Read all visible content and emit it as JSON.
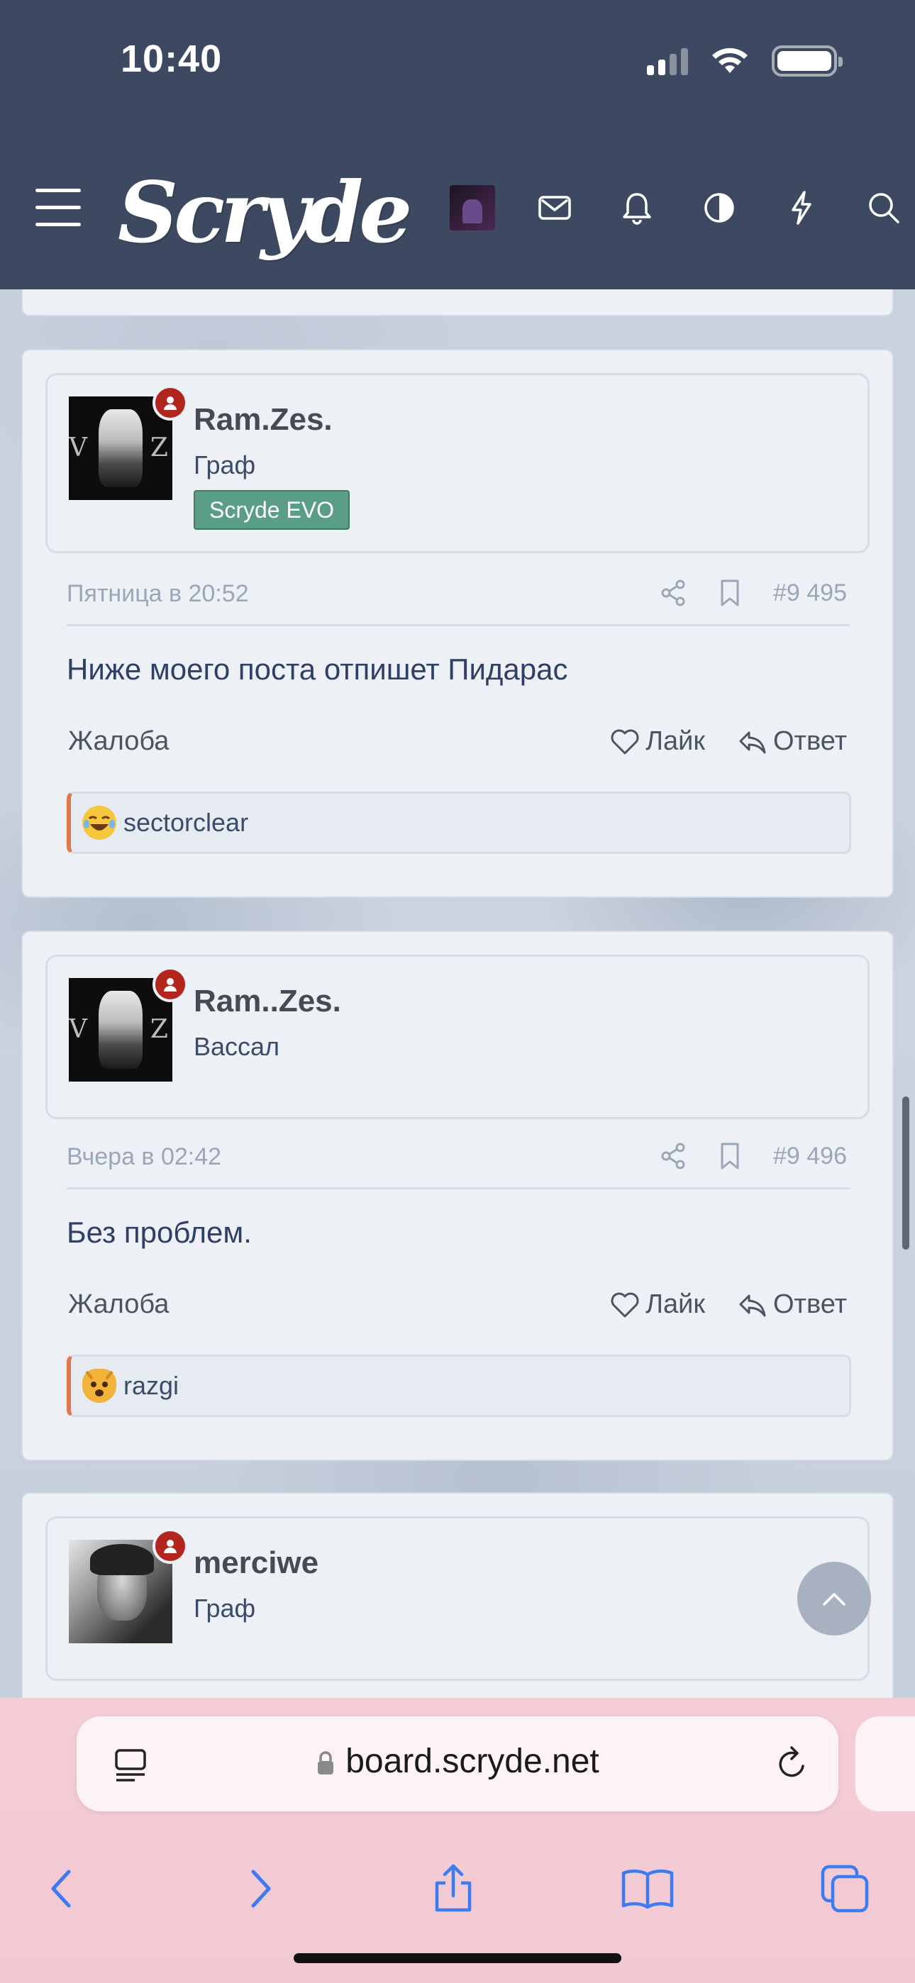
{
  "status_bar": {
    "time": "10:40"
  },
  "header": {
    "logo": "Scryde",
    "icons": [
      "menu-icon",
      "user-avatar",
      "mail-icon",
      "bell-icon",
      "contrast-icon",
      "bolt-icon",
      "search-icon"
    ]
  },
  "posts": [
    {
      "username": "Ram.Zes.",
      "user_title": "Граф",
      "banner": "Scryde EVO",
      "date": "Пятница в 20:52",
      "post_number": "#9 495",
      "text": "Ниже моего поста отпишет Пидарас",
      "report_label": "Жалоба",
      "like_label": "Лайк",
      "reply_label": "Ответ",
      "reaction_user": "sectorclear",
      "reaction_icon": "laughing-emoji-icon"
    },
    {
      "username": "Ram..Zes.",
      "user_title": "Вассал",
      "date": "Вчера в 02:42",
      "post_number": "#9 496",
      "text": "Без проблем.",
      "report_label": "Жалоба",
      "like_label": "Лайк",
      "reply_label": "Ответ",
      "reaction_user": "razgi",
      "reaction_icon": "cat-emoji-icon"
    },
    {
      "username": "merciwe",
      "user_title": "Граф"
    }
  ],
  "browser": {
    "url": "board.scryde.net"
  },
  "colors": {
    "header_bg": "#3c4960",
    "banner_bg": "#5b9e86",
    "online_badge": "#b3261e",
    "reaction_accent": "#e0784a",
    "safari_bg": "#f4cdd6"
  }
}
